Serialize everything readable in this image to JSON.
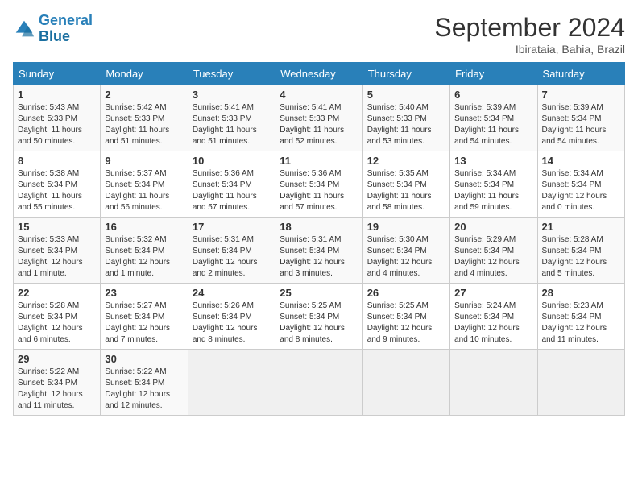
{
  "header": {
    "logo_line1": "General",
    "logo_line2": "Blue",
    "month_title": "September 2024",
    "location": "Ibirataia, Bahia, Brazil"
  },
  "weekdays": [
    "Sunday",
    "Monday",
    "Tuesday",
    "Wednesday",
    "Thursday",
    "Friday",
    "Saturday"
  ],
  "days": [
    {
      "date": "1",
      "sunrise": "5:43 AM",
      "sunset": "5:33 PM",
      "daylight": "11 hours and 50 minutes."
    },
    {
      "date": "2",
      "sunrise": "5:42 AM",
      "sunset": "5:33 PM",
      "daylight": "11 hours and 51 minutes."
    },
    {
      "date": "3",
      "sunrise": "5:41 AM",
      "sunset": "5:33 PM",
      "daylight": "11 hours and 51 minutes."
    },
    {
      "date": "4",
      "sunrise": "5:41 AM",
      "sunset": "5:33 PM",
      "daylight": "11 hours and 52 minutes."
    },
    {
      "date": "5",
      "sunrise": "5:40 AM",
      "sunset": "5:33 PM",
      "daylight": "11 hours and 53 minutes."
    },
    {
      "date": "6",
      "sunrise": "5:39 AM",
      "sunset": "5:34 PM",
      "daylight": "11 hours and 54 minutes."
    },
    {
      "date": "7",
      "sunrise": "5:39 AM",
      "sunset": "5:34 PM",
      "daylight": "11 hours and 54 minutes."
    },
    {
      "date": "8",
      "sunrise": "5:38 AM",
      "sunset": "5:34 PM",
      "daylight": "11 hours and 55 minutes."
    },
    {
      "date": "9",
      "sunrise": "5:37 AM",
      "sunset": "5:34 PM",
      "daylight": "11 hours and 56 minutes."
    },
    {
      "date": "10",
      "sunrise": "5:36 AM",
      "sunset": "5:34 PM",
      "daylight": "11 hours and 57 minutes."
    },
    {
      "date": "11",
      "sunrise": "5:36 AM",
      "sunset": "5:34 PM",
      "daylight": "11 hours and 57 minutes."
    },
    {
      "date": "12",
      "sunrise": "5:35 AM",
      "sunset": "5:34 PM",
      "daylight": "11 hours and 58 minutes."
    },
    {
      "date": "13",
      "sunrise": "5:34 AM",
      "sunset": "5:34 PM",
      "daylight": "11 hours and 59 minutes."
    },
    {
      "date": "14",
      "sunrise": "5:34 AM",
      "sunset": "5:34 PM",
      "daylight": "12 hours and 0 minutes."
    },
    {
      "date": "15",
      "sunrise": "5:33 AM",
      "sunset": "5:34 PM",
      "daylight": "12 hours and 1 minute."
    },
    {
      "date": "16",
      "sunrise": "5:32 AM",
      "sunset": "5:34 PM",
      "daylight": "12 hours and 1 minute."
    },
    {
      "date": "17",
      "sunrise": "5:31 AM",
      "sunset": "5:34 PM",
      "daylight": "12 hours and 2 minutes."
    },
    {
      "date": "18",
      "sunrise": "5:31 AM",
      "sunset": "5:34 PM",
      "daylight": "12 hours and 3 minutes."
    },
    {
      "date": "19",
      "sunrise": "5:30 AM",
      "sunset": "5:34 PM",
      "daylight": "12 hours and 4 minutes."
    },
    {
      "date": "20",
      "sunrise": "5:29 AM",
      "sunset": "5:34 PM",
      "daylight": "12 hours and 4 minutes."
    },
    {
      "date": "21",
      "sunrise": "5:28 AM",
      "sunset": "5:34 PM",
      "daylight": "12 hours and 5 minutes."
    },
    {
      "date": "22",
      "sunrise": "5:28 AM",
      "sunset": "5:34 PM",
      "daylight": "12 hours and 6 minutes."
    },
    {
      "date": "23",
      "sunrise": "5:27 AM",
      "sunset": "5:34 PM",
      "daylight": "12 hours and 7 minutes."
    },
    {
      "date": "24",
      "sunrise": "5:26 AM",
      "sunset": "5:34 PM",
      "daylight": "12 hours and 8 minutes."
    },
    {
      "date": "25",
      "sunrise": "5:25 AM",
      "sunset": "5:34 PM",
      "daylight": "12 hours and 8 minutes."
    },
    {
      "date": "26",
      "sunrise": "5:25 AM",
      "sunset": "5:34 PM",
      "daylight": "12 hours and 9 minutes."
    },
    {
      "date": "27",
      "sunrise": "5:24 AM",
      "sunset": "5:34 PM",
      "daylight": "12 hours and 10 minutes."
    },
    {
      "date": "28",
      "sunrise": "5:23 AM",
      "sunset": "5:34 PM",
      "daylight": "12 hours and 11 minutes."
    },
    {
      "date": "29",
      "sunrise": "5:22 AM",
      "sunset": "5:34 PM",
      "daylight": "12 hours and 11 minutes."
    },
    {
      "date": "30",
      "sunrise": "5:22 AM",
      "sunset": "5:34 PM",
      "daylight": "12 hours and 12 minutes."
    }
  ]
}
